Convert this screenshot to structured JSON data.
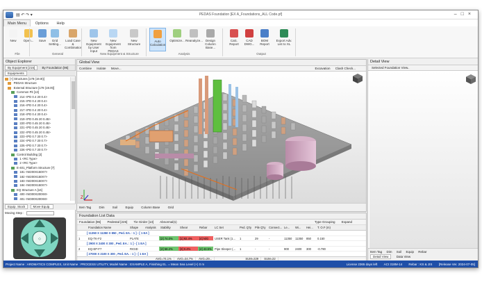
{
  "window": {
    "title": "PEDAS Foundation [EX A_Foundations_ALL Code.pf]"
  },
  "menu": {
    "items": [
      "Main Menu",
      "Options",
      "Help"
    ]
  },
  "ribbon": {
    "buttons": [
      {
        "label": "New",
        "color": "#f4f4f4"
      },
      {
        "label": "Open...",
        "color": "#f2c14e"
      },
      {
        "label": "Save",
        "color": "#6a9ed8"
      },
      {
        "label": "Grid Setting...",
        "color": "#8fbfe6"
      },
      {
        "label": "Load Case & Combination",
        "color": "#d9a66a"
      },
      {
        "label": "New Equipment by User Input",
        "color": "#9ec5ea"
      },
      {
        "label": "New Equipment from PEDAS",
        "color": "#b9d7f3"
      },
      {
        "label": "New Structure",
        "color": "#c9c9c9"
      },
      {
        "label": "Auto Calculation",
        "color": "#f0a040"
      },
      {
        "label": "Optimize...",
        "color": "#9fcf7f"
      },
      {
        "label": "Reanalyze...",
        "color": "#c0c0c0"
      },
      {
        "label": "Design Column Base...",
        "color": "#a9a9a9"
      },
      {
        "label": "Calc. Report",
        "color": "#d85050"
      },
      {
        "label": "CAD DWG...",
        "color": "#d04040"
      },
      {
        "label": "BOM Report",
        "color": "#4a7fc8"
      },
      {
        "label": "Export Adv. List to XL",
        "color": "#2e8b57"
      }
    ],
    "groups": [
      "File",
      "General",
      "New Equipment & Structure",
      "Analysis",
      "Output"
    ]
  },
  "object_explorer": {
    "title": "Object Explorer",
    "tabs": [
      "By Equipment [215]",
      "By Foundation [96]"
    ],
    "subtab": "Equipments",
    "tree": [
      "[+] Structures [178 (19.0t)]",
      "  PEDAS Structure",
      "  External Structure [178 (19.0t)]",
      "    Common Pit [13]",
      "      214 <PD 0.4 20 0.4>",
      "      215 <PD 0.4 20 0.4>",
      "      216 <PD 0.4 20 0.4>",
      "      217 <PD 0.4 20 0.4>",
      "      218 <PD 0.4 20 0.4>",
      "      219 <PD 0.45 20 0.45>",
      "      220 <PD 0.45 20 0.45>",
      "      221 <PD 0.45 20 0.45>",
      "      222 <PD 0.45 20 0.45>",
      "      223 <PD 0.7 20 0.7>",
      "      224 <PD 0.7 20 0.7>",
      "      225 <PD 0.7 20 0.7>",
      "      226 <PD 0.7 20 0.7>",
      "    Control Building [2]",
      "      1 <RC Type>",
      "      2 <RC Type>",
      "    E-401_Platform Structure [7]",
      "      181 <W200X150X7>",
      "      182 <W200X150X7>",
      "      183 <W200X150X7>",
      "      184 <W200X150X7>",
      "    EQ Structure A [16]",
      "      400 <W300X200X8>",
      "      401 <W300X200X8>"
    ],
    "nav_tabs": [
      "Equip. Stock",
      "Move Equip."
    ],
    "move_step_label": "Moving Step :",
    "move_step_value": "1000"
  },
  "global_view": {
    "title": "Global View",
    "toolbar": [
      "Combine",
      "Isolate",
      "Move..."
    ],
    "toolbar_right": [
      "Excavation",
      "Clash Check..."
    ],
    "tabs": [
      "Item Tag",
      "Dim",
      "Soil",
      "Equip",
      "Column Base",
      "Grid"
    ]
  },
  "foundation_list": {
    "title": "Foundation List Data",
    "tabs": [
      "Foundation [96]",
      "Pedestal [226]",
      "Tie Girder [13]",
      "Abnormal(s)"
    ],
    "tabs_right": [
      "Type Grouping",
      "Expand"
    ],
    "headers": [
      "Foundation Name",
      "Shape",
      "Analysis",
      "Stability",
      "Shear",
      "Rebar",
      "LC Set",
      "Ped. Q'ty",
      "Pile Q'ty",
      "Connect...",
      "Le...",
      "Wi...",
      "Hei...",
      "T. O.F (m)"
    ],
    "rows": [
      {
        "type": "group",
        "text": "[ 11350 X 11350 X 850 , Ped. EA. : 1 ] - [ 1 EA ]"
      },
      {
        "type": "data",
        "num": "1",
        "name": "EQ-TK-F2",
        "shape": "PLATE",
        "stab": "[2] 74.0%",
        "shear": "[1] 92.4%",
        "rebar": "[4] N/G",
        "lc": "USER Tank (1...",
        "ped": "1",
        "pile": "29",
        "conn": "-",
        "le": "11350",
        "wi": "11350",
        "hei": "850",
        "pad": "700",
        "tof": "0.150"
      },
      {
        "type": "group",
        "text": "[ 2900 X 2400 X 300 , Ped. EA. : 1 ] - [ 1 EA ]"
      },
      {
        "type": "data",
        "num": "2",
        "name": "EQ-EP-F7",
        "shape": "RIGID",
        "stab": "[4] 58.2%",
        "shear": "[3] 0.4%",
        "rebar": "[4] 43.5%",
        "lc": "Pipe Sleeper (...",
        "ped": "1",
        "pile": "-",
        "conn": "-",
        "le": "900",
        "wi": "2400",
        "hei": "300",
        "pad": "700",
        "tof": "-0.790"
      },
      {
        "type": "group",
        "text": "[ 27000 X 2100 X 300 , Ped. EA. : 1 ] - [ 1 EA ]"
      }
    ],
    "summary": [
      "AVG=74.1%",
      "AVG=34.7%",
      "AVG=29...",
      "SUM=229",
      "SUM=22"
    ]
  },
  "detail_view": {
    "title": "Detail View",
    "toolbar": "Selected Foundation View..",
    "tabs": [
      "Item Tag",
      "Dim",
      "Soil",
      "Equip",
      "Rebar"
    ],
    "bottom_tabs": [
      "Detail View",
      "Data View"
    ]
  },
  "status": {
    "left": "Project Name : AROMATICS COMPLEX, Unit Name : PROCESS  UTILITY, Model Name : EXAMPLE A, Finishing EL. = Mean Sea Level (+) 0 m",
    "right": [
      "License 2365 days left",
      "ACI 318M-14",
      "Rebar : KS & JIS",
      "[Release Ver. 2024-07-05]"
    ]
  },
  "colors": {
    "accent": "#1f4fa8",
    "highlight": "#cde4fb",
    "pass": "#6fc56f",
    "fail": "#f06060"
  }
}
